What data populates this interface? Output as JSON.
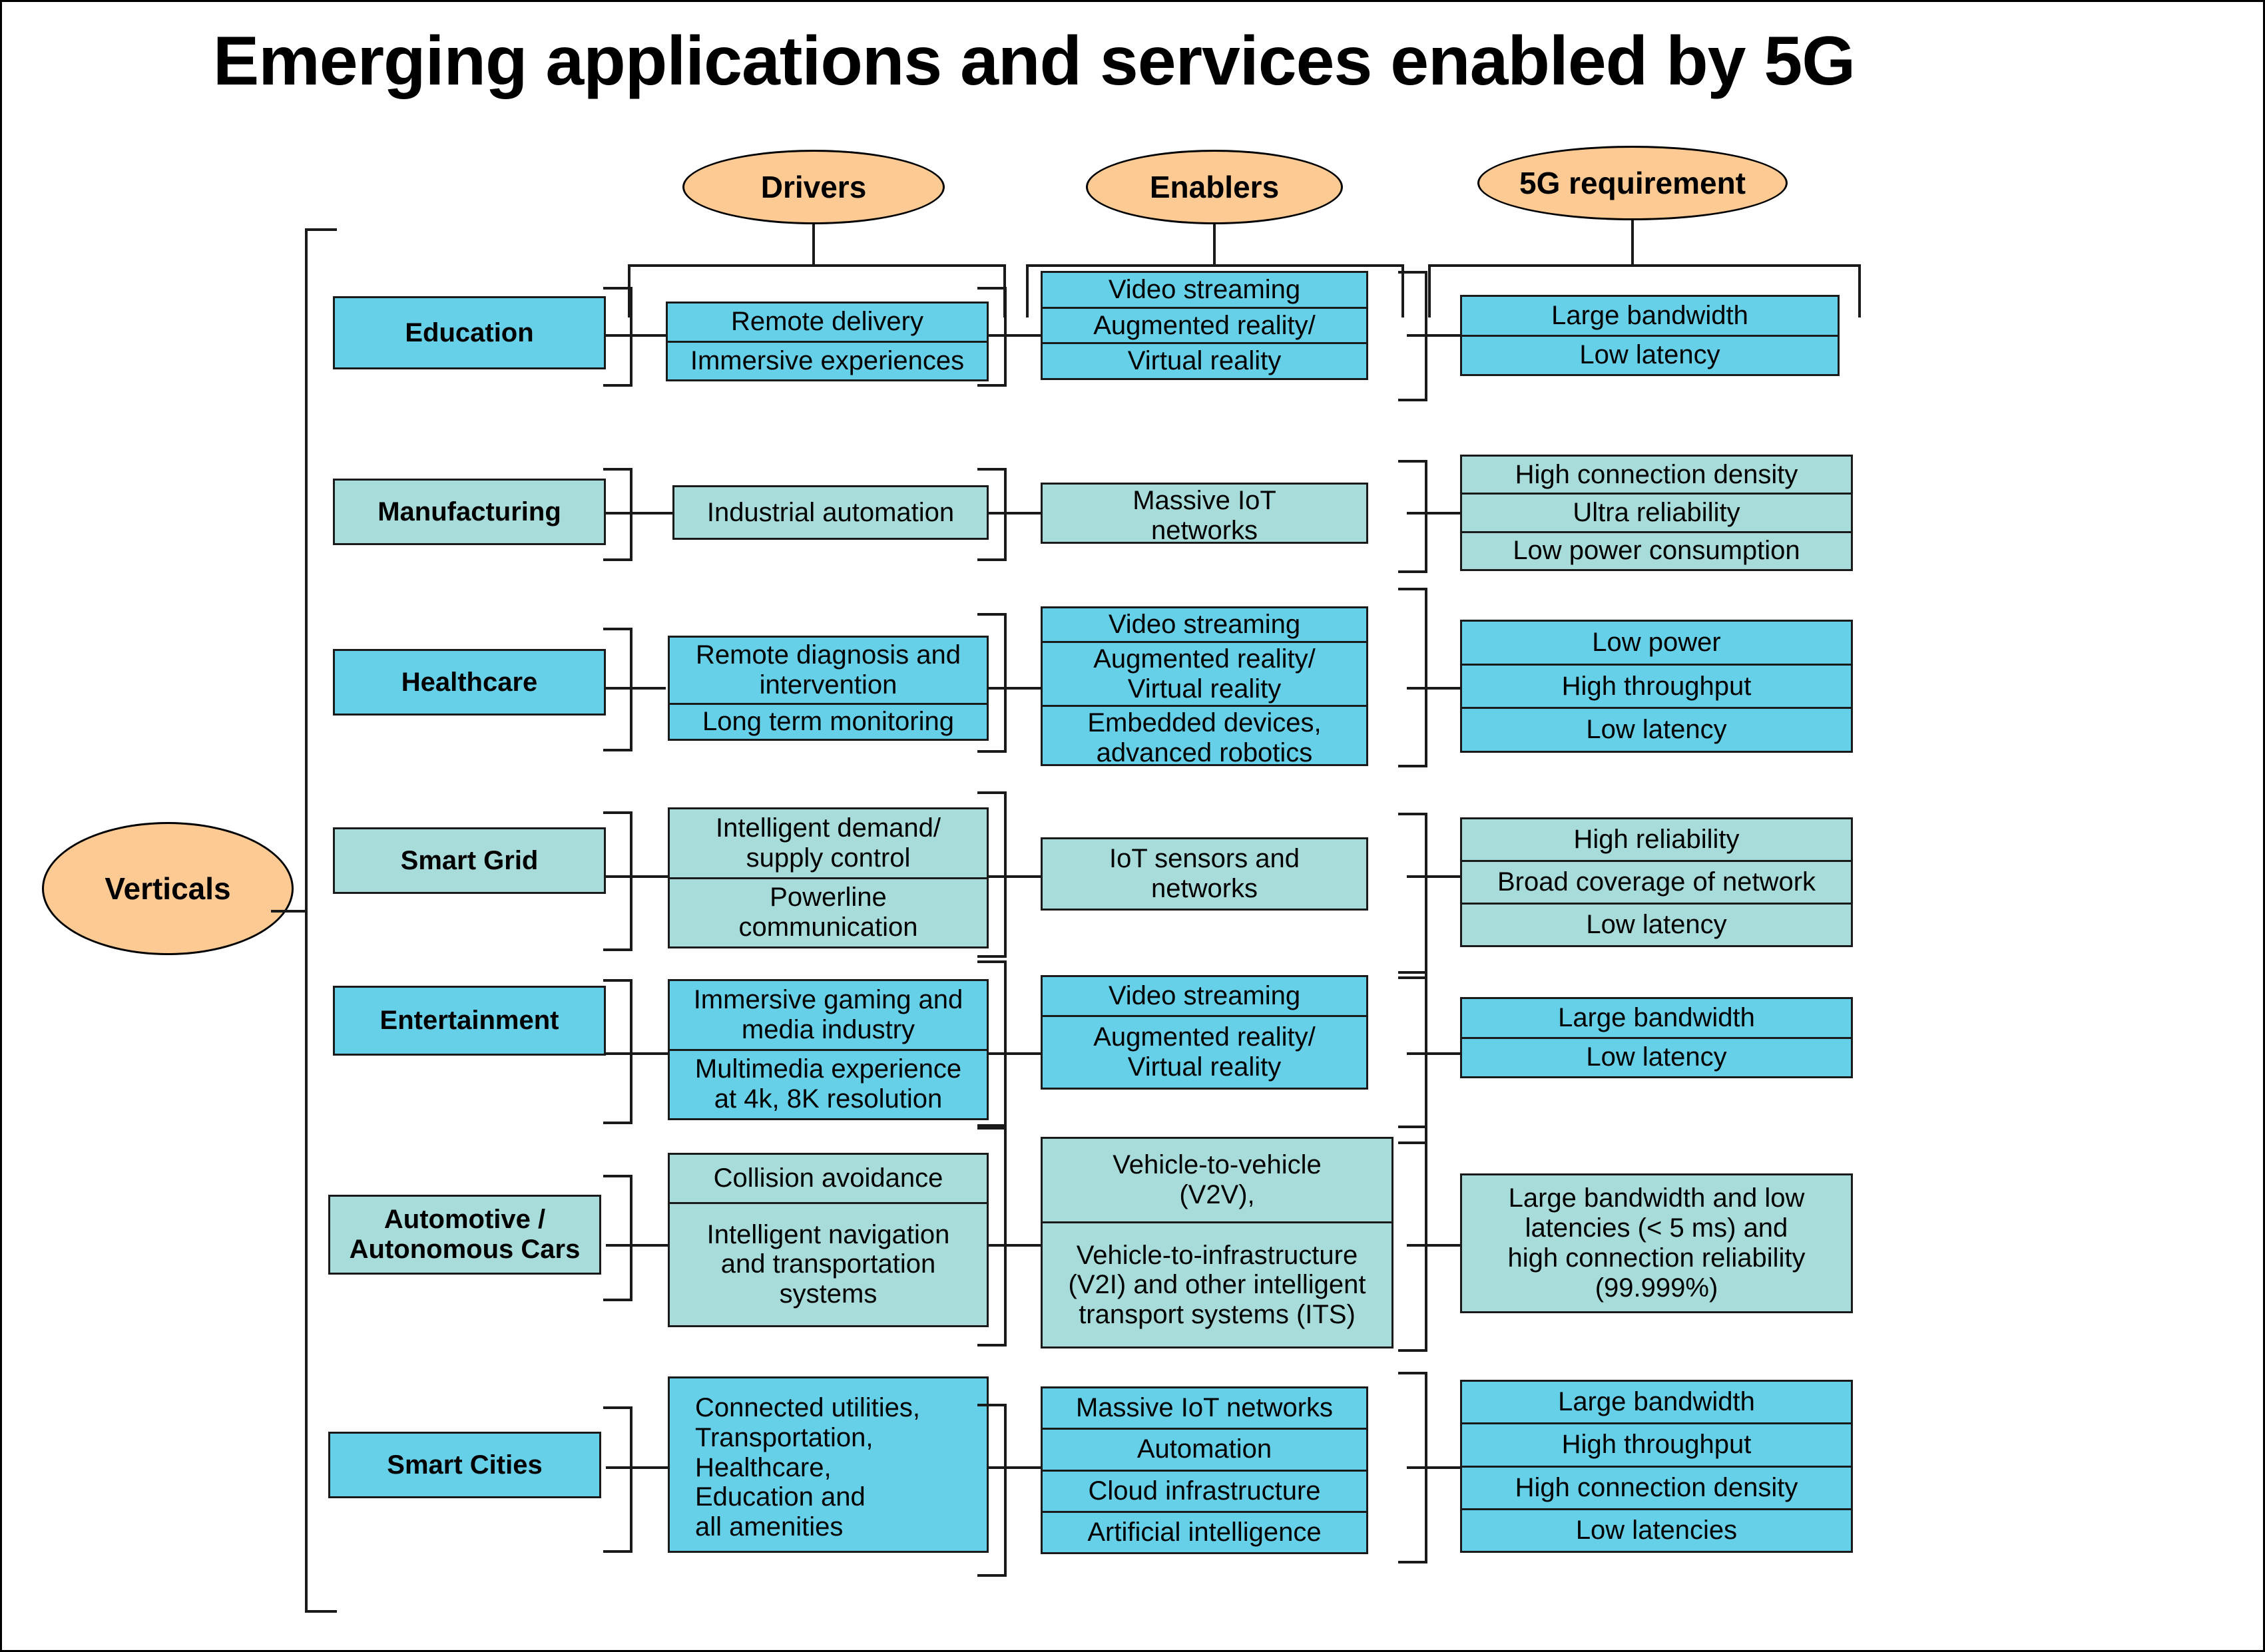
{
  "title": "Emerging applications and services enabled by 5G",
  "colors": {
    "cyan": "#66D0E8",
    "teal": "#A8DCDA",
    "orange": "#FCCA92",
    "line": "#1a1a1a"
  },
  "ellipses": {
    "verticals": "Verticals",
    "drivers": "Drivers",
    "enablers": "Enablers",
    "requirement": "5G requirement"
  },
  "columns": [
    "Verticals",
    "Drivers",
    "Enablers",
    "5G requirement"
  ],
  "rows": [
    {
      "vertical": "Education",
      "tone": "cyan",
      "drivers": [
        "Remote delivery",
        "Immersive experiences"
      ],
      "enablers": [
        "Video streaming",
        "Augmented reality/",
        "Virtual reality"
      ],
      "requirements": [
        "Large bandwidth",
        "Low latency"
      ]
    },
    {
      "vertical": "Manufacturing",
      "tone": "teal",
      "drivers": [
        "Industrial automation"
      ],
      "enablers": [
        "Massive IoT\nnetworks"
      ],
      "requirements": [
        "High connection density",
        "Ultra reliability",
        "Low power consumption"
      ]
    },
    {
      "vertical": "Healthcare",
      "tone": "cyan",
      "drivers": [
        "Remote diagnosis and\nintervention",
        "Long term monitoring"
      ],
      "enablers": [
        "Video streaming",
        "Augmented reality/\nVirtual reality",
        "Embedded devices,\nadvanced robotics"
      ],
      "requirements": [
        "Low power",
        "High throughput",
        "Low latency"
      ]
    },
    {
      "vertical": "Smart Grid",
      "tone": "teal",
      "drivers": [
        "Intelligent demand/\nsupply control",
        "Powerline\ncommunication"
      ],
      "enablers": [
        "IoT sensors and\nnetworks"
      ],
      "requirements": [
        "High reliability",
        "Broad coverage of network",
        "Low latency"
      ]
    },
    {
      "vertical": "Entertainment",
      "tone": "cyan",
      "drivers": [
        "Immersive gaming and\nmedia industry",
        "Multimedia experience\nat 4k, 8K resolution"
      ],
      "enablers": [
        "Video streaming",
        "Augmented reality/\nVirtual reality"
      ],
      "requirements": [
        "Large bandwidth",
        "Low latency"
      ]
    },
    {
      "vertical": "Automotive /\nAutonomous Cars",
      "tone": "teal",
      "drivers": [
        "Collision avoidance",
        "Intelligent navigation\nand transportation\nsystems"
      ],
      "enablers": [
        "Vehicle-to-vehicle\n(V2V),",
        "Vehicle-to-infrastructure\n(V2I) and other intelligent\ntransport systems (ITS)"
      ],
      "requirements": [
        "Large bandwidth and low\nlatencies (< 5 ms) and\nhigh connection reliability\n(99.999%)"
      ]
    },
    {
      "vertical": "Smart Cities",
      "tone": "cyan",
      "drivers": [
        "Connected utilities,\n Transportation,\nHealthcare,\nEducation and\nall amenities"
      ],
      "enablers": [
        "Massive IoT networks",
        "Automation",
        "Cloud infrastructure",
        "Artificial intelligence"
      ],
      "requirements": [
        "Large bandwidth",
        "High throughput",
        "High connection density",
        "Low latencies"
      ]
    }
  ]
}
